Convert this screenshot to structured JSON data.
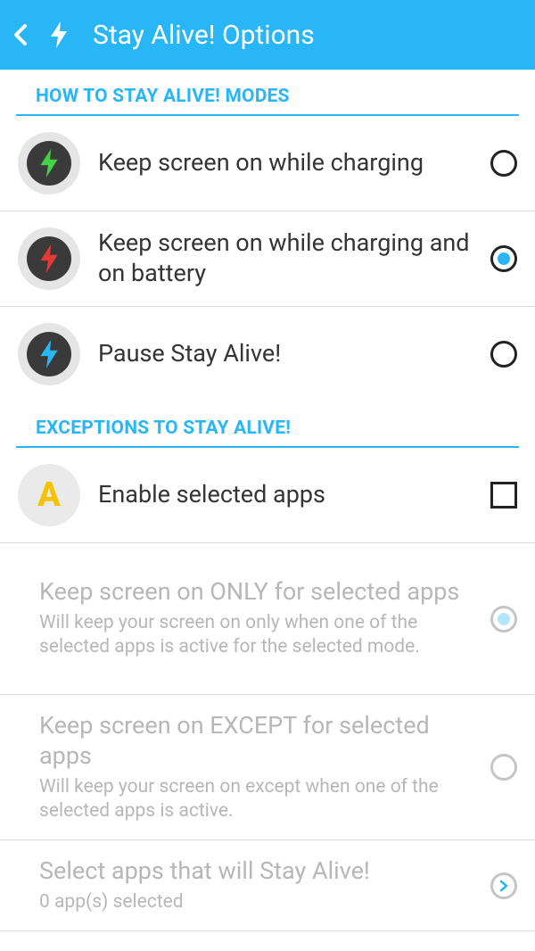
{
  "header": {
    "title": "Stay Alive! Options"
  },
  "sections": {
    "modes": {
      "header": "HOW TO STAY ALIVE! MODES",
      "items": [
        {
          "title": "Keep screen on while charging"
        },
        {
          "title": "Keep screen on while charging and on battery"
        },
        {
          "title": "Pause Stay Alive!"
        }
      ]
    },
    "exceptions": {
      "header": "EXCEPTIONS TO STAY ALIVE!",
      "enable": {
        "title": "Enable selected apps"
      },
      "only": {
        "title": "Keep screen on ONLY for selected apps",
        "subtitle": "Will keep your screen on only when one of the selected apps is active for the selected mode."
      },
      "except": {
        "title": "Keep screen on EXCEPT for selected apps",
        "subtitle": "Will keep your screen on except when one of the selected apps is active."
      },
      "select": {
        "title": "Select apps that will Stay Alive!",
        "subtitle": "0 app(s) selected"
      }
    }
  }
}
